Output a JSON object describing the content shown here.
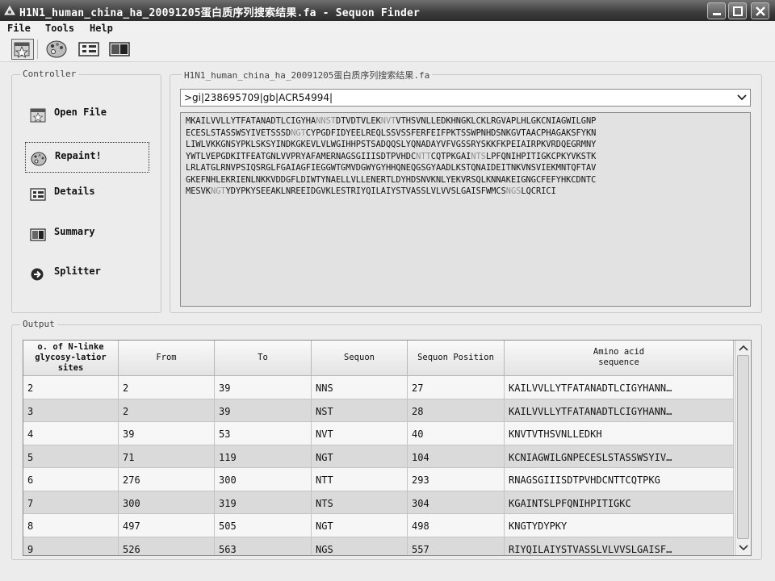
{
  "window": {
    "title": "H1N1_human_china_ha_20091205蛋白质序列搜索结果.fa - Sequon Finder"
  },
  "menu": {
    "file": "File",
    "tools": "Tools",
    "help": "Help"
  },
  "toolbar": {
    "icons": [
      "open-file-icon",
      "palette-icon",
      "details-icon",
      "summary-icon"
    ]
  },
  "controller": {
    "title": "Controller",
    "buttons": [
      {
        "label": "Open File",
        "icon": "open-file-icon"
      },
      {
        "label": "Repaint!",
        "icon": "palette-icon"
      },
      {
        "label": "Details",
        "icon": "details-icon"
      },
      {
        "label": "Summary",
        "icon": "summary-icon"
      },
      {
        "label": "Splitter",
        "icon": "arrow-right-icon"
      }
    ]
  },
  "file_panel": {
    "title": "H1N1_human_china_ha_20091205蛋白质序列搜索结果.fa",
    "selected_sequence": ">gi|238695709|gb|ACR54994|",
    "sequence_lines": [
      [
        [
          "MKAILVVLLYTFATANADTLCIGYHA",
          false
        ],
        [
          "NNST",
          true
        ],
        [
          "DTVDTVLEK",
          false
        ],
        [
          "NVT",
          true
        ],
        [
          "VTHSVNLLEDKHNGKLCKLRGVAPLHLGKCNIAGWILGNP",
          false
        ]
      ],
      [
        [
          "ECESLSTASSWSYIVETSSSD",
          false
        ],
        [
          "NGT",
          true
        ],
        [
          "CYPGDFIDYEELREQLSSVSSFERFEIFPKTSSWPNHDSNKGVTAACPHAGAKSFYKN",
          false
        ]
      ],
      [
        [
          "LIWLVKKGNSYPKLSKSYINDKGKEVLVLWGIHHPSTSADQQSLYQNADAYVFVGSSRYSKKFKPEIAIRPKVRDQEGRMNY",
          false
        ]
      ],
      [
        [
          "YWTLVEPGDKITFEATGNLVVPRYAFAMERNAGSGIIISDTPVHDC",
          false
        ],
        [
          "NTT",
          true
        ],
        [
          "CQTPKGAI",
          false
        ],
        [
          "NTS",
          true
        ],
        [
          "LPFQNIHPITIGKCPKYVKSTK",
          false
        ]
      ],
      [
        [
          "LRLATGLRNVPSIQSRGLFGAIAGFIEGGWTGMVDGWYGYHHQNEQGSGYAADLKSTQNAIDEITNKVNSVIEKMNTQFTAV",
          false
        ]
      ],
      [
        [
          "GKEFNHLEKRIENLNKKVDDGFLDIWTYNAELLVLLENERTLDYHDSNVKNLYEKVRSQLKNNAKEIGNGCFEFYHKCDNTC",
          false
        ]
      ],
      [
        [
          "MESVK",
          false
        ],
        [
          "NGT",
          true
        ],
        [
          "YDYPKYSEEAKLNREEIDGVKLESTRIYQILAIYSTVASSLVLVVSLGAISFWMCS",
          false
        ],
        [
          "NGS",
          true
        ],
        [
          "LQCRICI",
          false
        ]
      ]
    ]
  },
  "output": {
    "title": "Output",
    "columns": [
      "o. of N-linke\nglycosy-latior\nsites",
      "From",
      "To",
      "Sequon",
      "Sequon Position",
      "Amino acid\nsequence"
    ],
    "rows": [
      [
        "2",
        "2",
        "39",
        "NNS",
        "27",
        "KAILVVLLYTFATANADTLCIGYHANN…"
      ],
      [
        "3",
        "2",
        "39",
        "NST",
        "28",
        "KAILVVLLYTFATANADTLCIGYHANN…"
      ],
      [
        "4",
        "39",
        "53",
        "NVT",
        "40",
        "KNVTVTHSVNLLEDKH"
      ],
      [
        "5",
        "71",
        "119",
        "NGT",
        "104",
        "KCNIAGWILGNPECESLSTASSWSYIV…"
      ],
      [
        "6",
        "276",
        "300",
        "NTT",
        "293",
        "RNAGSGIIISDTPVHDCNTTCQTPKG"
      ],
      [
        "7",
        "300",
        "319",
        "NTS",
        "304",
        "KGAINTSLPFQNIHPITIGKC"
      ],
      [
        "8",
        "497",
        "505",
        "NGT",
        "498",
        "KNGTYDYPKY"
      ],
      [
        "9",
        "526",
        "563",
        "NGS",
        "557",
        "RIYQILAIYSTVASSLVLVVSLGAISF…"
      ]
    ]
  }
}
